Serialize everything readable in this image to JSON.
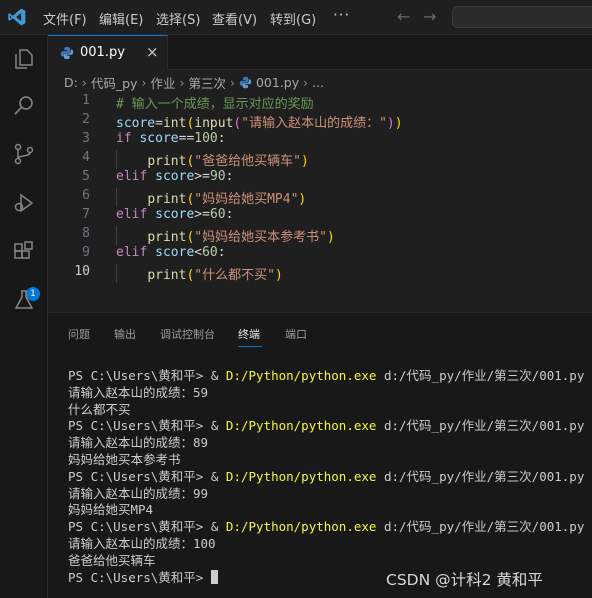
{
  "menu": [
    "文件(F)",
    "编辑(E)",
    "选择(S)",
    "查看(V)",
    "转到(G)"
  ],
  "menu_more": "···",
  "nav": {
    "back": "←",
    "forward": "→"
  },
  "activity_badge": "1",
  "tab": {
    "label": "001.py",
    "close": "×"
  },
  "breadcrumb": [
    "D:",
    "代码_py",
    "作业",
    "第三次",
    "001.py",
    "..."
  ],
  "editor": {
    "line_numbers": [
      "1",
      "2",
      "3",
      "4",
      "5",
      "6",
      "7",
      "8",
      "9",
      "10"
    ],
    "active_line": 10,
    "lines": [
      [
        {
          "t": "# 输入一个成绩，显示对应的奖励",
          "c": "cm"
        }
      ],
      [
        {
          "t": "score",
          "c": "var"
        },
        {
          "t": "=",
          "c": "op"
        },
        {
          "t": "int",
          "c": "fn"
        },
        {
          "t": "(",
          "c": "pn"
        },
        {
          "t": "input",
          "c": "fn"
        },
        {
          "t": "(",
          "c": "pn2"
        },
        {
          "t": "\"请输入赵本山的成绩：\"",
          "c": "str"
        },
        {
          "t": ")",
          "c": "pn2"
        },
        {
          "t": ")",
          "c": "pn"
        }
      ],
      [
        {
          "t": "if ",
          "c": "kw"
        },
        {
          "t": "score",
          "c": "var"
        },
        {
          "t": "==",
          "c": "op"
        },
        {
          "t": "100",
          "c": "num"
        },
        {
          "t": ":",
          "c": "op"
        }
      ],
      [
        {
          "t": "    ",
          "c": "op"
        },
        {
          "t": "print",
          "c": "fn"
        },
        {
          "t": "(",
          "c": "pn"
        },
        {
          "t": "\"爸爸给他买辆车\"",
          "c": "str"
        },
        {
          "t": ")",
          "c": "pn"
        }
      ],
      [
        {
          "t": "elif ",
          "c": "kw"
        },
        {
          "t": "score",
          "c": "var"
        },
        {
          "t": ">=",
          "c": "op"
        },
        {
          "t": "90",
          "c": "num"
        },
        {
          "t": ":",
          "c": "op"
        }
      ],
      [
        {
          "t": "    ",
          "c": "op"
        },
        {
          "t": "print",
          "c": "fn"
        },
        {
          "t": "(",
          "c": "pn"
        },
        {
          "t": "\"妈妈给她买MP4\"",
          "c": "str"
        },
        {
          "t": ")",
          "c": "pn"
        }
      ],
      [
        {
          "t": "elif ",
          "c": "kw"
        },
        {
          "t": "score",
          "c": "var"
        },
        {
          "t": ">=",
          "c": "op"
        },
        {
          "t": "60",
          "c": "num"
        },
        {
          "t": ":",
          "c": "op"
        }
      ],
      [
        {
          "t": "    ",
          "c": "op"
        },
        {
          "t": "print",
          "c": "fn"
        },
        {
          "t": "(",
          "c": "pn"
        },
        {
          "t": "\"妈妈给她买本参考书\"",
          "c": "str"
        },
        {
          "t": ")",
          "c": "pn"
        }
      ],
      [
        {
          "t": "elif ",
          "c": "kw"
        },
        {
          "t": "score",
          "c": "var"
        },
        {
          "t": "<",
          "c": "op"
        },
        {
          "t": "60",
          "c": "num"
        },
        {
          "t": ":",
          "c": "op"
        }
      ],
      [
        {
          "t": "    ",
          "c": "op"
        },
        {
          "t": "print",
          "c": "fn"
        },
        {
          "t": "(",
          "c": "pn"
        },
        {
          "t": "\"什么都不买\"",
          "c": "str"
        },
        {
          "t": ")",
          "c": "pn"
        }
      ]
    ]
  },
  "panel": {
    "tabs": [
      "问题",
      "输出",
      "调试控制台",
      "终端",
      "端口"
    ],
    "active_tab": "终端",
    "terminal_lines": [
      {
        "prompt": "PS C:\\Users\\黄和平> & ",
        "exe": "D:/Python/python.exe",
        "rest": " d:/代码_py/作业/第三次/001.py"
      },
      {
        "text": "请输入赵本山的成绩：59"
      },
      {
        "text": "什么都不买"
      },
      {
        "prompt": "PS C:\\Users\\黄和平> & ",
        "exe": "D:/Python/python.exe",
        "rest": " d:/代码_py/作业/第三次/001.py"
      },
      {
        "text": "请输入赵本山的成绩：89"
      },
      {
        "text": "妈妈给她买本参考书"
      },
      {
        "prompt": "PS C:\\Users\\黄和平> & ",
        "exe": "D:/Python/python.exe",
        "rest": " d:/代码_py/作业/第三次/001.py"
      },
      {
        "text": "请输入赵本山的成绩：99"
      },
      {
        "text": "妈妈给她买MP4"
      },
      {
        "prompt": "PS C:\\Users\\黄和平> & ",
        "exe": "D:/Python/python.exe",
        "rest": " d:/代码_py/作业/第三次/001.py"
      },
      {
        "text": "请输入赵本山的成绩：100"
      },
      {
        "text": "爸爸给他买辆车"
      },
      {
        "prompt": "PS C:\\Users\\黄和平> ",
        "cursor": true
      }
    ],
    "watermark": "CSDN @计科2 黄和平"
  },
  "colors": {
    "accent": "#0078d4",
    "background": "#1f1f1f",
    "exe_path": "#f5f543"
  }
}
